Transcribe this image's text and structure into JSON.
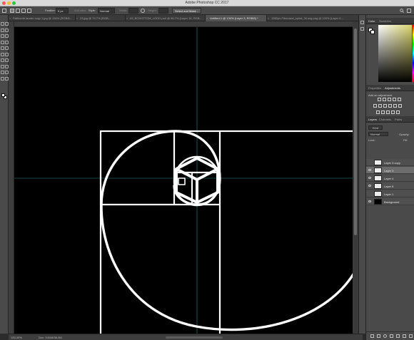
{
  "window": {
    "title": "Adobe Photoshop CC 2017",
    "traffic_light_colors": [
      "#ff5f57",
      "#febc2e",
      "#28c840"
    ]
  },
  "options_bar": {
    "feather_label": "Feather:",
    "feather_value": "0 px",
    "anti_alias_label": "Anti-alias",
    "style_label": "Style:",
    "style_value": "Normal",
    "width_label": "Width:",
    "height_label": "Height:",
    "select_mask_label": "Select and Mask..."
  },
  "tabs": [
    {
      "label": "Pathlorde lander copy 1.jpg @ 134% (RGB/8...",
      "active": false
    },
    {
      "label": "23.jpg @ 79.7% (RGB...",
      "active": false
    },
    {
      "label": "09_BOXOTTOM_LOGO.psd @ 66.7% (Layer 15, RGB...",
      "active": false
    },
    {
      "label": "Untitled-1 @ 134% (Layer 3, RGB/8) *",
      "active": true
    },
    {
      "label": "1280px-Fibonacci_spiral_34.svg.png @ 100% (Layer 0...",
      "active": false
    }
  ],
  "status": {
    "zoom": "133.33%",
    "doc": "Doc: 3.61M/36.0M"
  },
  "color_panel": {
    "tabs": [
      "Color",
      "Swatches"
    ],
    "accent_color": "#d8d36a"
  },
  "adjustments_panel": {
    "tabs": [
      "Properties",
      "Adjustments"
    ],
    "add_label": "Add an adjustment"
  },
  "layers_panel": {
    "tabs": [
      "Layers",
      "Channels",
      "Paths"
    ],
    "kind_label": "Kind",
    "blend_mode": "Normal",
    "opacity_label": "Opacity:",
    "lock_label": "Lock:",
    "fill_label": "Fill:",
    "layers": [
      {
        "name": "Layer 3 copy",
        "visible": false,
        "selected": false,
        "thumb": "#ececec"
      },
      {
        "name": "Layer 3",
        "visible": true,
        "selected": true,
        "thumb": "#ececec"
      },
      {
        "name": "Layer 4",
        "visible": true,
        "selected": false,
        "thumb": "#ececec"
      },
      {
        "name": "Layer 5",
        "visible": true,
        "selected": false,
        "thumb": "#ececec"
      },
      {
        "name": "Layer 1",
        "visible": false,
        "selected": false,
        "thumb": "#ececec"
      },
      {
        "name": "Background",
        "visible": true,
        "selected": false,
        "thumb": "#000000"
      }
    ]
  },
  "tools": [
    "move-tool-icon",
    "marquee-tool-icon",
    "lasso-tool-icon",
    "quick-select-icon",
    "crop-tool-icon",
    "eyedropper-icon",
    "healing-brush-icon",
    "brush-tool-icon",
    "clone-stamp-icon",
    "history-brush-icon",
    "eraser-icon",
    "gradient-icon",
    "blur-icon",
    "dodge-icon",
    "pen-tool-icon",
    "type-tool-icon",
    "path-select-icon",
    "shape-tool-icon",
    "hand-tool-icon",
    "zoom-tool-icon"
  ],
  "canvas": {
    "background": "#000000",
    "stroke": "#ffffff",
    "guide": "#2f8c8c"
  }
}
